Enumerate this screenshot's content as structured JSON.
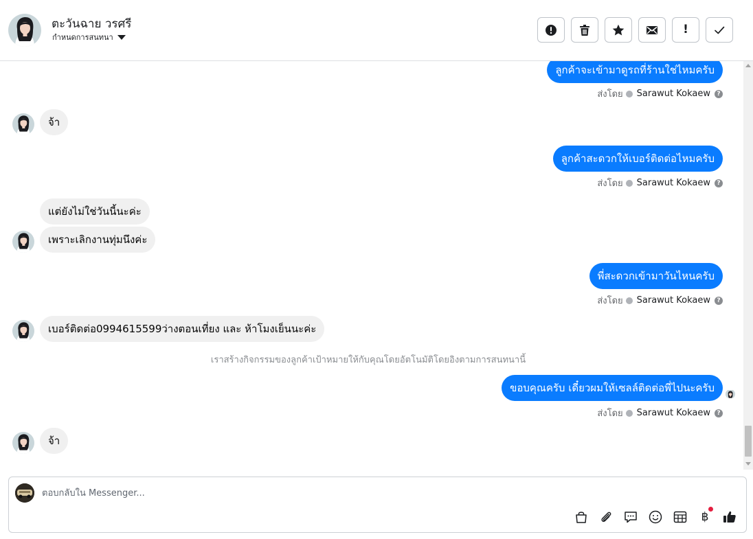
{
  "header": {
    "contact_name": "ตะวันฉาย วรศรี",
    "assign_label": "กำหนดการสนทนา",
    "toolbar": [
      {
        "name": "spam-button",
        "icon": "alert-circle-icon"
      },
      {
        "name": "delete-button",
        "icon": "trash-icon"
      },
      {
        "name": "star-button",
        "icon": "star-icon"
      },
      {
        "name": "mark-unread-button",
        "icon": "envelope-icon"
      },
      {
        "name": "follow-up-button",
        "icon": "exclamation-icon",
        "glyph": "!"
      },
      {
        "name": "mark-done-button",
        "icon": "check-icon"
      }
    ]
  },
  "thread": {
    "sent_by_label": "ส่งโดย",
    "agent_name": "Sarawut Kokaew",
    "messages": [
      {
        "dir": "out",
        "text": "ลูกค้าจะเข้ามาดูรถที่ร้านใช่ไหมครับ",
        "sent_by": true
      },
      {
        "dir": "in",
        "text": "จ้า",
        "avatar": true
      },
      {
        "dir": "out",
        "text": "ลูกค้าสะดวกให้เบอร์ติดต่อไหมครับ",
        "sent_by": true
      },
      {
        "dir": "in",
        "text": "แต่ยังไม่ใช่วันนี้นะค่ะ",
        "avatar": false
      },
      {
        "dir": "in",
        "text": "เพราะเลิกงานทุ่มนึงค่ะ",
        "avatar": true
      },
      {
        "dir": "out",
        "text": "พี่สะดวกเข้ามาวันไหนครับ",
        "sent_by": true
      },
      {
        "dir": "in",
        "text": "เบอร์ติดต่อ0994615599ว่างตอนเที่ยง และ ห้าโมงเย็นนะค่ะ",
        "avatar": true
      },
      {
        "dir": "out",
        "text": "ขอบคุณครับ เดี๋ยวผมให้เซลล์ติดต่อพี่ไปนะครับ",
        "sent_by": true
      },
      {
        "dir": "in",
        "text": "จ้า",
        "avatar": true
      }
    ],
    "system_note": "เราสร้างกิจกรรมของลูกค้าเป้าหมายให้กับคุณโดยอัตโนมัติโดยอิงตามการสนทนานี้"
  },
  "composer": {
    "placeholder": "ตอบกลับใน Messenger...",
    "tools": [
      "shopping-bag-icon",
      "paperclip-icon",
      "chat-bubble-icon",
      "emoji-icon",
      "table-icon",
      "baht-icon",
      "thumbs-up-icon"
    ],
    "baht_glyph": "฿"
  },
  "colors": {
    "outgoing_bubble": "#0a7cff",
    "incoming_bubble": "#f0f0f0",
    "notification_dot": "#e41e3f"
  }
}
